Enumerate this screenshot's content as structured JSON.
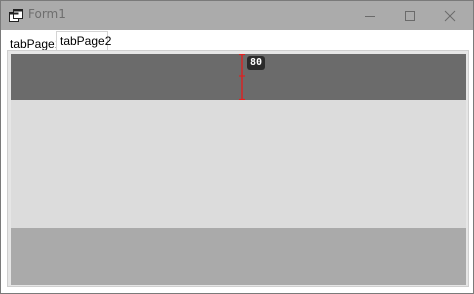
{
  "window": {
    "title": "Form1",
    "icon": "form-app-icon",
    "controls": {
      "minimize": "minimize-icon",
      "maximize": "maximize-icon",
      "close": "close-icon"
    }
  },
  "tabs": [
    {
      "label": "tabPage1",
      "selected": false
    },
    {
      "label": "tabPage2",
      "selected": true
    }
  ],
  "panel": {
    "top_band_color": "#6b6b6b",
    "middle_band_color": "#dcdcdc",
    "bottom_band_color": "#aaaaaa",
    "splitter_handle_color": "#e02020",
    "size_readout": "80"
  }
}
